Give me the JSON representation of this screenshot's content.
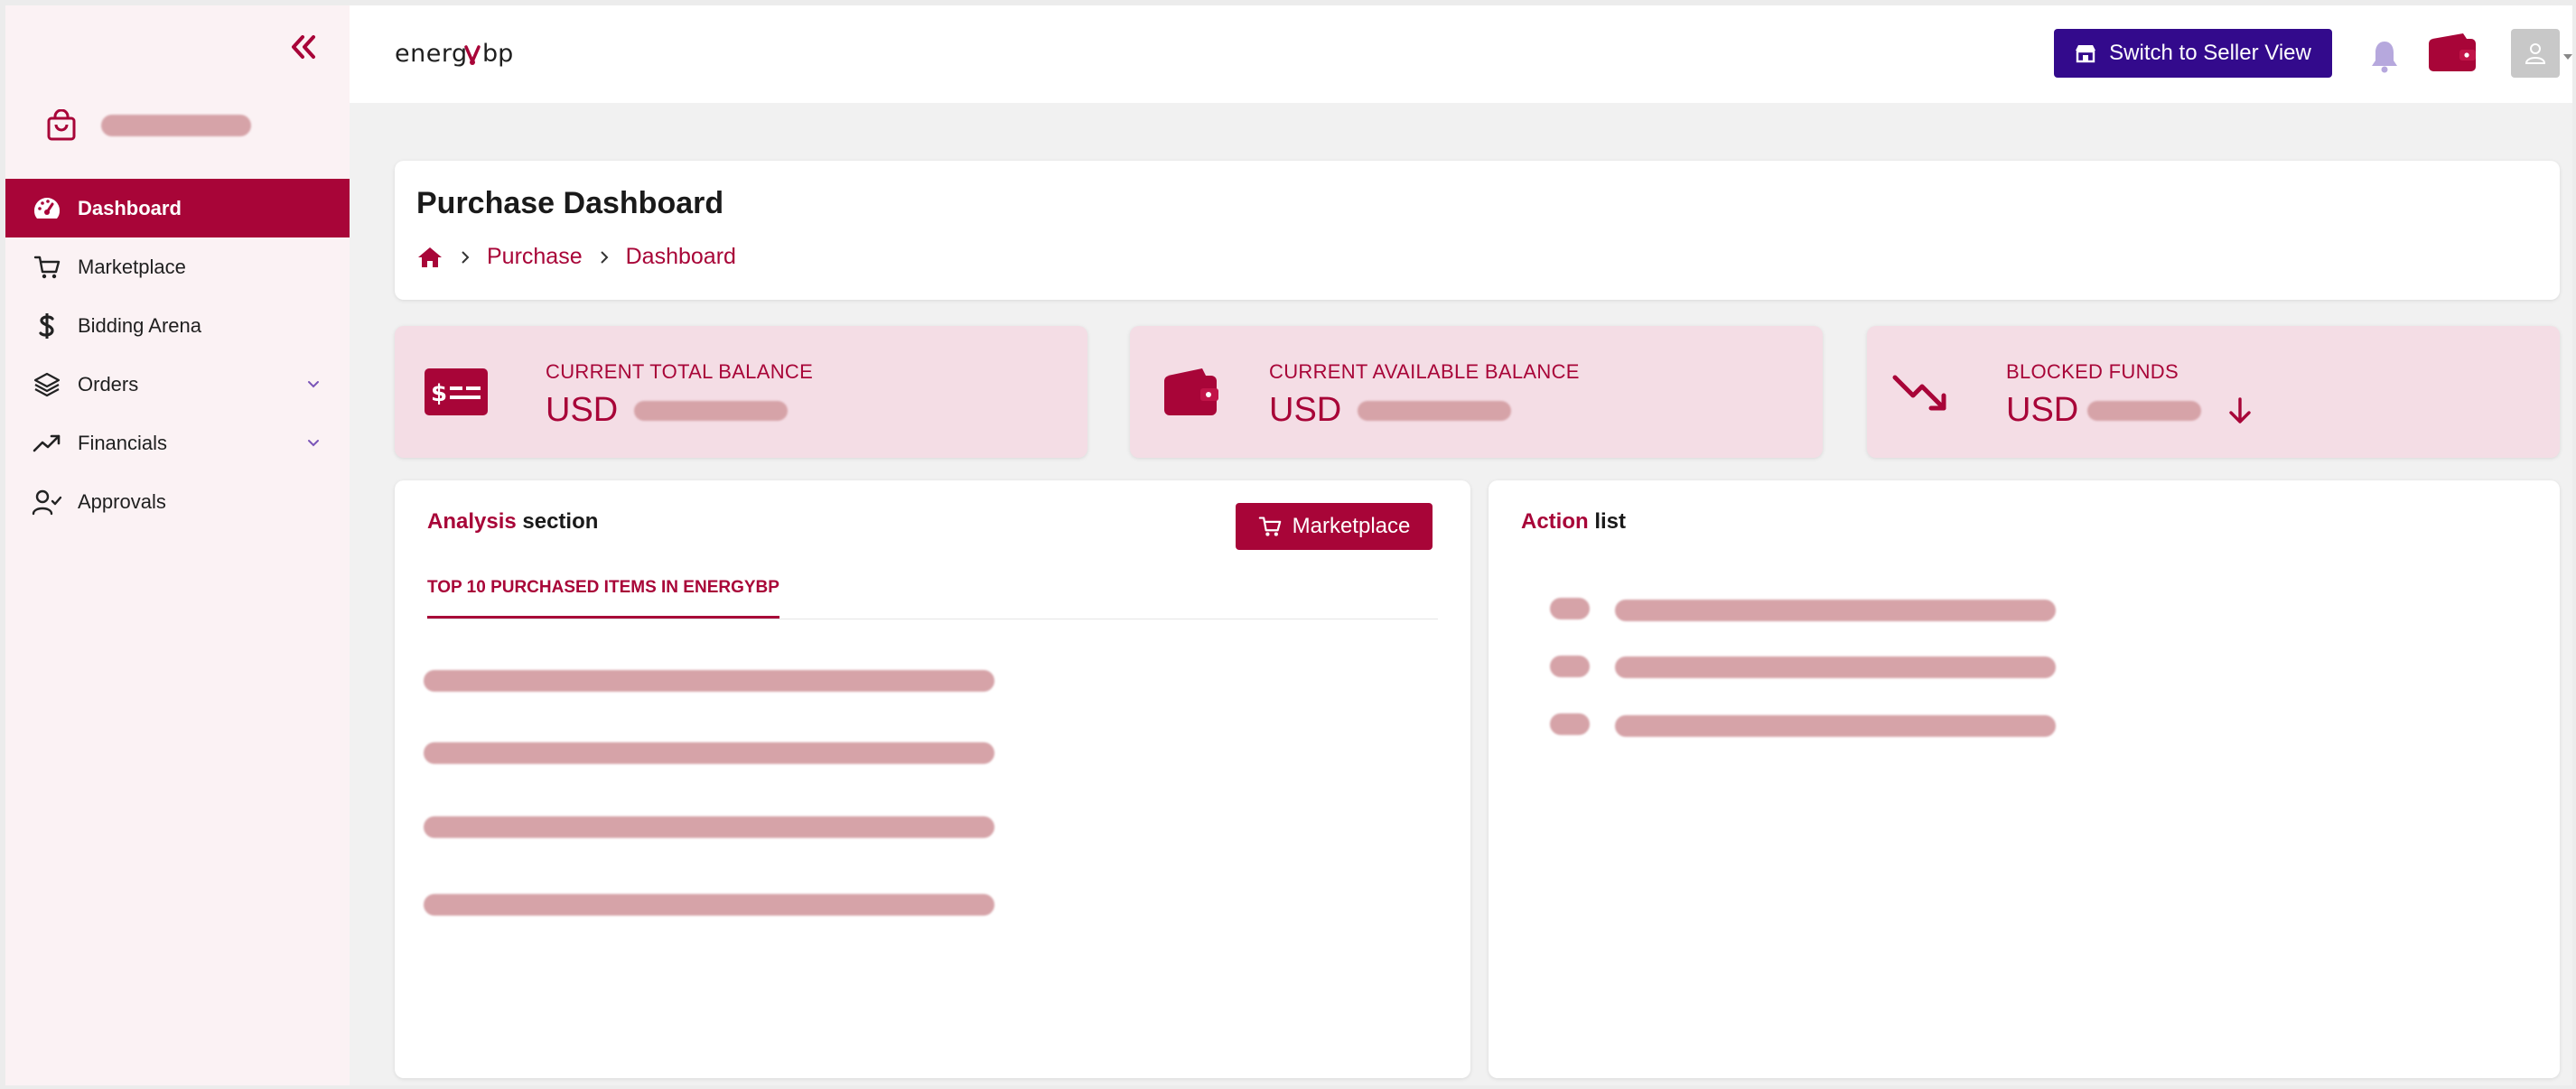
{
  "sidebar": {
    "items": [
      {
        "label": "Dashboard"
      },
      {
        "label": "Marketplace"
      },
      {
        "label": "Bidding Arena"
      },
      {
        "label": "Orders"
      },
      {
        "label": "Financials"
      },
      {
        "label": "Approvals"
      }
    ]
  },
  "header": {
    "logo_text": "energybp",
    "switch_label": "Switch to Seller View"
  },
  "page": {
    "title": "Purchase Dashboard",
    "breadcrumb": [
      "Purchase",
      "Dashboard"
    ]
  },
  "stats": [
    {
      "label": "CURRENT TOTAL BALANCE",
      "currency": "USD"
    },
    {
      "label": "CURRENT AVAILABLE BALANCE",
      "currency": "USD"
    },
    {
      "label": "BLOCKED FUNDS",
      "currency": "USD"
    }
  ],
  "analysis": {
    "title_accent": "Analysis",
    "title_rest": " section",
    "button_label": "Marketplace",
    "tab_label": "TOP 10 PURCHASED ITEMS IN ENERGYBP"
  },
  "actions": {
    "title_accent": "Action",
    "title_rest": " list"
  },
  "colors": {
    "brand": "#a80538",
    "seller_button": "#330a8c",
    "stat_bg": "#f4dde5",
    "sidebar_bg": "#fbf2f4"
  }
}
